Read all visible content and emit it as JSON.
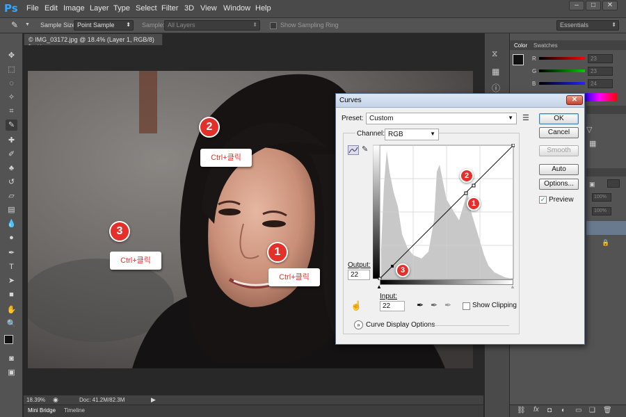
{
  "app": {
    "logo": "Ps"
  },
  "menu": [
    "File",
    "Edit",
    "Image",
    "Layer",
    "Type",
    "Select",
    "Filter",
    "3D",
    "View",
    "Window",
    "Help"
  ],
  "options_bar": {
    "sample_size_label": "Sample Size:",
    "sample_size_value": "Point Sample",
    "sample_label": "Sample:",
    "sample_value": "All Layers",
    "show_ring_label": "Show Sampling Ring",
    "workspace": "Essentials"
  },
  "document": {
    "tab_title": "© IMG_03172.jpg @ 18.4% (Layer 1, RGB/8) *",
    "zoom": "18.39%",
    "doc_info": "Doc: 41.2M/82.3M"
  },
  "bottom_tabs": [
    "Mini Bridge",
    "Timeline"
  ],
  "panels": {
    "color_tab": "Color",
    "swatches_tab": "Swatches",
    "channels": [
      {
        "label": "R",
        "value": "23"
      },
      {
        "label": "G",
        "value": "23"
      },
      {
        "label": "B",
        "value": "24"
      }
    ],
    "opacity_value": "100%",
    "fill_value": "100%"
  },
  "annotations": [
    {
      "num": "1",
      "label": "Ctrl+클릭"
    },
    {
      "num": "2",
      "label": "Ctrl+클릭"
    },
    {
      "num": "3",
      "label": "Ctrl+클릭"
    }
  ],
  "curves": {
    "title": "Curves",
    "preset_label": "Preset:",
    "preset_value": "Custom",
    "channel_label": "Channel:",
    "channel_value": "RGB",
    "output_label": "Output:",
    "output_value": "22",
    "input_label": "Input:",
    "input_value": "22",
    "show_clipping_label": "Show Clipping",
    "display_options_label": "Curve Display Options",
    "buttons": {
      "ok": "OK",
      "cancel": "Cancel",
      "smooth": "Smooth",
      "auto": "Auto",
      "options": "Options..."
    },
    "preview_label": "Preview",
    "preview_checked": true,
    "point_labels": [
      "1",
      "2",
      "3"
    ]
  },
  "colors": {
    "accent_red": "#e3302a",
    "ps_blue": "#31a8ff",
    "dialog_bg": "#f0f0f0"
  }
}
